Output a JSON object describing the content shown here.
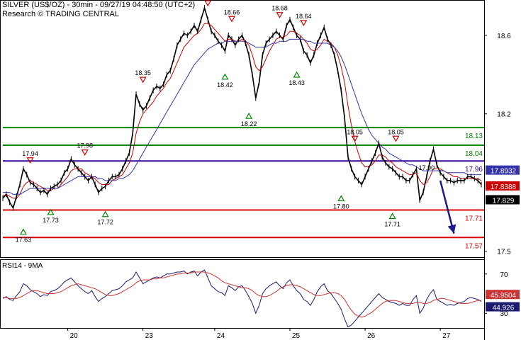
{
  "header": {
    "title": "SILVER (US$/OZ) - 30min - 09/27/19 04:48:50 (UTC+2)",
    "subtitle": "Research © TRADING CENTRAL"
  },
  "colors": {
    "price": "#000000",
    "ma_fast": "#cc0000",
    "ma_slow": "#3333aa",
    "resistance": "#008800",
    "pivot": "#330099",
    "support": "#dd0000",
    "arrow": "#1a1a8c",
    "high_marker": "#cc0000",
    "low_marker": "#008800",
    "rsi": "#1a1a6e",
    "rsi_ma": "#cc3333"
  },
  "chart_data": [
    {
      "type": "line",
      "title": "SILVER (US$/OZ) - 30min - 09/27/19 04:48:50 (UTC+2)",
      "ylim": [
        17.47,
        18.78
      ],
      "y_ticks": [
        "18.6",
        "18.2",
        "17.5"
      ],
      "y_tick_values": [
        18.6,
        18.2,
        17.5
      ],
      "x_ticks": [
        "20",
        "23",
        "24",
        "25",
        "26",
        "27"
      ],
      "x_tick_positions": [
        19,
        41,
        62,
        84,
        106,
        128
      ],
      "x_range": [
        0,
        140
      ],
      "grid": false,
      "series": [
        {
          "values": [
            17.77,
            17.79,
            17.75,
            17.72,
            17.78,
            17.84,
            17.92,
            17.89,
            17.85,
            17.84,
            17.82,
            17.8,
            17.81,
            17.79,
            17.82,
            17.83,
            17.84,
            17.86,
            17.9,
            17.92,
            17.97,
            17.94,
            17.92,
            17.9,
            17.88,
            17.86,
            17.88,
            17.84,
            17.8,
            17.82,
            17.83,
            17.86,
            17.88,
            17.88,
            17.89,
            17.92,
            17.96,
            18.0,
            18.1,
            18.3,
            18.25,
            18.22,
            18.24,
            18.28,
            18.32,
            18.34,
            18.33,
            18.35,
            18.4,
            18.42,
            18.48,
            18.55,
            18.58,
            18.61,
            18.6,
            18.62,
            18.65,
            18.62,
            18.68,
            18.74,
            18.68,
            18.62,
            18.6,
            18.57,
            18.55,
            18.52,
            18.6,
            18.58,
            18.55,
            18.58,
            18.6,
            18.56,
            18.5,
            18.4,
            18.28,
            18.36,
            18.5,
            18.56,
            18.58,
            18.6,
            18.62,
            18.6,
            18.58,
            18.65,
            18.68,
            18.64,
            18.6,
            18.58,
            18.52,
            18.5,
            18.46,
            18.5,
            18.56,
            18.6,
            18.64,
            18.58,
            18.55,
            18.5,
            18.42,
            18.32,
            18.18,
            17.98,
            17.92,
            17.88,
            17.86,
            17.84,
            17.88,
            17.92,
            17.96,
            18.0,
            18.05,
            17.98,
            17.95,
            17.93,
            17.92,
            17.9,
            17.88,
            17.88,
            17.86,
            17.86,
            17.89,
            17.92,
            17.76,
            17.8,
            17.88,
            17.96,
            18.02,
            17.94,
            17.9,
            17.88,
            17.86,
            17.86,
            17.85,
            17.86,
            17.86,
            17.86,
            17.88,
            17.88,
            17.87,
            17.86,
            17.84
          ]
        },
        {
          "values": [
            17.78,
            17.79,
            17.78,
            17.77,
            17.77,
            17.79,
            17.83,
            17.85,
            17.86,
            17.85,
            17.84,
            17.83,
            17.82,
            17.81,
            17.81,
            17.82,
            17.82,
            17.84,
            17.86,
            17.88,
            17.91,
            17.92,
            17.92,
            17.92,
            17.9,
            17.89,
            17.88,
            17.87,
            17.85,
            17.84,
            17.84,
            17.84,
            17.86,
            17.87,
            17.88,
            17.89,
            17.92,
            17.95,
            18.0,
            18.1,
            18.16,
            18.2,
            18.22,
            18.24,
            18.26,
            18.29,
            18.31,
            18.33,
            18.36,
            18.38,
            18.42,
            18.46,
            18.5,
            18.54,
            18.56,
            18.58,
            18.6,
            18.61,
            18.63,
            18.66,
            18.66,
            18.65,
            18.63,
            18.61,
            18.59,
            18.57,
            18.58,
            18.58,
            18.57,
            18.57,
            18.58,
            18.57,
            18.55,
            18.5,
            18.44,
            18.42,
            18.44,
            18.48,
            18.52,
            18.55,
            18.58,
            18.59,
            18.59,
            18.6,
            18.62,
            18.62,
            18.61,
            18.6,
            18.58,
            18.56,
            18.53,
            18.52,
            18.53,
            18.55,
            18.58,
            18.57,
            18.56,
            18.54,
            18.5,
            18.44,
            18.36,
            18.24,
            18.14,
            18.06,
            18.0,
            17.95,
            17.93,
            17.93,
            17.94,
            17.96,
            17.99,
            17.99,
            17.98,
            17.96,
            17.95,
            17.93,
            17.92,
            17.91,
            17.9,
            17.89,
            17.89,
            17.9,
            17.86,
            17.84,
            17.85,
            17.88,
            17.92,
            17.92,
            17.92,
            17.91,
            17.9,
            17.89,
            17.88,
            17.88,
            17.87,
            17.87,
            17.87,
            17.87,
            17.87,
            17.87,
            17.86
          ]
        },
        {
          "values": [
            17.8,
            17.8,
            17.8,
            17.79,
            17.79,
            17.79,
            17.8,
            17.81,
            17.82,
            17.82,
            17.82,
            17.82,
            17.82,
            17.82,
            17.82,
            17.82,
            17.82,
            17.83,
            17.84,
            17.85,
            17.86,
            17.87,
            17.88,
            17.88,
            17.88,
            17.88,
            17.88,
            17.88,
            17.87,
            17.87,
            17.86,
            17.86,
            17.86,
            17.86,
            17.87,
            17.87,
            17.88,
            17.89,
            17.91,
            17.94,
            17.97,
            18.0,
            18.03,
            18.06,
            18.09,
            18.12,
            18.15,
            18.18,
            18.21,
            18.24,
            18.27,
            18.3,
            18.33,
            18.36,
            18.39,
            18.42,
            18.45,
            18.47,
            18.49,
            18.51,
            18.53,
            18.54,
            18.55,
            18.56,
            18.56,
            18.57,
            18.57,
            18.57,
            18.57,
            18.57,
            18.57,
            18.57,
            18.56,
            18.55,
            18.54,
            18.54,
            18.54,
            18.54,
            18.55,
            18.56,
            18.56,
            18.57,
            18.57,
            18.57,
            18.58,
            18.58,
            18.58,
            18.58,
            18.58,
            18.57,
            18.57,
            18.56,
            18.56,
            18.56,
            18.56,
            18.56,
            18.55,
            18.54,
            18.52,
            18.49,
            18.45,
            18.4,
            18.35,
            18.3,
            18.25,
            18.2,
            18.16,
            18.12,
            18.09,
            18.07,
            18.05,
            18.03,
            18.02,
            18.0,
            17.99,
            17.98,
            17.97,
            17.96,
            17.95,
            17.94,
            17.94,
            17.93,
            17.92,
            17.91,
            17.91,
            17.91,
            17.91,
            17.91,
            17.91,
            17.91,
            17.9,
            17.9,
            17.9,
            17.9,
            17.9,
            17.9,
            17.89,
            17.89,
            17.89,
            17.89,
            17.89
          ]
        }
      ],
      "levels": [
        {
          "value": 18.13,
          "label": "18.13",
          "kind": "resistance"
        },
        {
          "value": 18.04,
          "label": "18.04",
          "kind": "resistance"
        },
        {
          "value": 17.96,
          "label": "17.96",
          "kind": "pivot"
        },
        {
          "value": 17.71,
          "label": "17.71",
          "kind": "support"
        },
        {
          "value": 17.57,
          "label": "17.57",
          "kind": "support"
        }
      ],
      "markers": [
        {
          "x": 8,
          "y": 17.94,
          "label": "17.94",
          "kind": "high"
        },
        {
          "x": 24,
          "y": 17.98,
          "label": "17.98",
          "kind": "high"
        },
        {
          "x": 41,
          "y": 18.35,
          "label": "18.35",
          "kind": "high"
        },
        {
          "x": 60,
          "y": 18.74,
          "label": "18.74",
          "kind": "high"
        },
        {
          "x": 67,
          "y": 18.66,
          "label": "18.66",
          "kind": "high"
        },
        {
          "x": 81,
          "y": 18.68,
          "label": "18.68",
          "kind": "high"
        },
        {
          "x": 88,
          "y": 18.64,
          "label": "18.64",
          "kind": "high"
        },
        {
          "x": 103,
          "y": 18.05,
          "label": "18.05",
          "kind": "high"
        },
        {
          "x": 115,
          "y": 18.05,
          "label": "18.05",
          "kind": "high"
        },
        {
          "x": 6,
          "y": 17.63,
          "label": "17.63",
          "kind": "low"
        },
        {
          "x": 14,
          "y": 17.73,
          "label": "17.73",
          "kind": "low"
        },
        {
          "x": 30,
          "y": 17.72,
          "label": "17.72",
          "kind": "low"
        },
        {
          "x": 65,
          "y": 18.42,
          "label": "18.42",
          "kind": "low"
        },
        {
          "x": 72,
          "y": 18.22,
          "label": "18.22",
          "kind": "low"
        },
        {
          "x": 86,
          "y": 18.43,
          "label": "18.43",
          "kind": "low"
        },
        {
          "x": 99,
          "y": 17.8,
          "label": "17.80",
          "kind": "low"
        },
        {
          "x": 114,
          "y": 17.71,
          "label": "17.71",
          "kind": "low"
        }
      ],
      "annotations": [
        {
          "x": 124,
          "y": 17.9,
          "label": "17.90"
        }
      ],
      "current_price_labels": [
        "17.8932",
        "17.8388",
        "17.829"
      ],
      "arrow": {
        "from": [
          128,
          17.86
        ],
        "to": [
          132,
          17.59
        ]
      }
    },
    {
      "type": "line",
      "title": "RSI14 - 9MA",
      "ylim": [
        15,
        85
      ],
      "y_ticks": [
        "70",
        "30"
      ],
      "y_tick_values": [
        70,
        30
      ],
      "x_range": [
        0,
        140
      ],
      "series": [
        {
          "values": [
            45,
            47,
            44,
            43,
            48,
            52,
            60,
            58,
            54,
            52,
            50,
            47,
            49,
            48,
            52,
            53,
            55,
            58,
            62,
            64,
            66,
            62,
            58,
            55,
            52,
            50,
            53,
            47,
            42,
            45,
            47,
            50,
            53,
            54,
            55,
            58,
            62,
            64,
            66,
            72,
            66,
            60,
            62,
            64,
            66,
            67,
            66,
            68,
            70,
            70,
            71,
            72,
            72,
            73,
            70,
            72,
            73,
            68,
            72,
            74,
            66,
            58,
            55,
            52,
            51,
            48,
            58,
            56,
            53,
            57,
            58,
            53,
            47,
            40,
            30,
            38,
            50,
            55,
            58,
            60,
            62,
            58,
            55,
            61,
            64,
            58,
            53,
            50,
            44,
            42,
            38,
            44,
            52,
            57,
            60,
            53,
            50,
            45,
            40,
            34,
            24,
            16,
            18,
            22,
            26,
            30,
            34,
            38,
            42,
            46,
            50,
            46,
            44,
            42,
            41,
            40,
            38,
            40,
            38,
            38,
            44,
            48,
            30,
            35,
            44,
            50,
            54,
            44,
            42,
            40,
            38,
            39,
            38,
            40,
            41,
            42,
            45,
            46,
            45,
            44,
            42
          ]
        },
        {
          "values": [
            46,
            46,
            45,
            45,
            45,
            46,
            48,
            50,
            52,
            53,
            53,
            52,
            51,
            50,
            50,
            50,
            51,
            52,
            54,
            56,
            58,
            59,
            60,
            59,
            58,
            57,
            56,
            55,
            53,
            51,
            49,
            48,
            48,
            49,
            50,
            52,
            54,
            56,
            58,
            61,
            63,
            64,
            64,
            64,
            65,
            65,
            66,
            66,
            67,
            68,
            69,
            70,
            70,
            71,
            71,
            71,
            72,
            72,
            72,
            72,
            71,
            70,
            68,
            66,
            63,
            61,
            60,
            59,
            58,
            57,
            56,
            56,
            55,
            53,
            50,
            48,
            47,
            47,
            48,
            50,
            52,
            55,
            57,
            58,
            59,
            59,
            58,
            57,
            55,
            53,
            51,
            49,
            48,
            48,
            49,
            50,
            51,
            51,
            50,
            48,
            44,
            38,
            33,
            29,
            27,
            26,
            27,
            29,
            31,
            34,
            37,
            40,
            42,
            43,
            43,
            43,
            42,
            41,
            40,
            40,
            40,
            41,
            41,
            40,
            40,
            41,
            43,
            44,
            45,
            45,
            44,
            43,
            42,
            41,
            40,
            40,
            40,
            41,
            42,
            43,
            43
          ]
        }
      ],
      "current_value_labels": [
        "45.9504",
        "44.926"
      ]
    }
  ]
}
